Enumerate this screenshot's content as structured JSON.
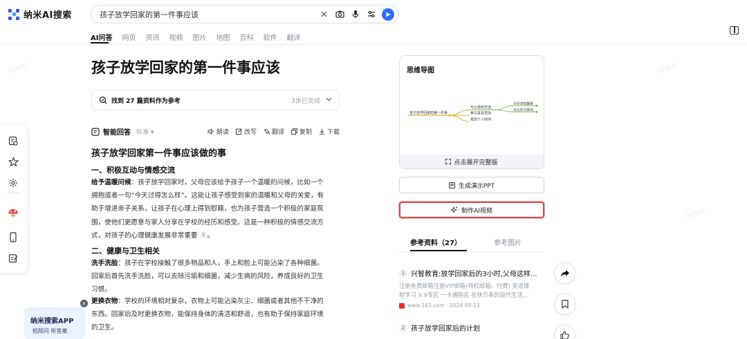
{
  "app": {
    "logo_text": "纳米AI搜索"
  },
  "search": {
    "value": "孩子放学回家的第一件事应该",
    "icons": [
      "clear-icon",
      "camera-icon",
      "microphone-icon",
      "settings-sliders-icon",
      "send-icon"
    ]
  },
  "tabs": [
    {
      "label": "AI问答",
      "active": true
    },
    {
      "label": "网页"
    },
    {
      "label": "资讯"
    },
    {
      "label": "视频"
    },
    {
      "label": "图片"
    },
    {
      "label": "地图"
    },
    {
      "label": "百科"
    },
    {
      "label": "软件"
    },
    {
      "label": "翻译"
    }
  ],
  "main": {
    "title": "孩子放学回家的第一件事应该",
    "ref_summary": {
      "label": "找到 27 篇资料作为参考",
      "steps": "3步已完成"
    },
    "answer": {
      "label": "智能回答",
      "mode": "标准",
      "tools": {
        "read": "朗读",
        "rewrite": "改写",
        "translate": "翻译",
        "copy": "复制",
        "download": "下载"
      }
    },
    "heading": "孩子放学回家第一件事应该做的事",
    "sections": [
      {
        "title": "一、积极互动与情感交流",
        "bold": "给予温暖问候",
        "lines": [
          "：孩子放学回家时，父母应该给予孩子一个温暖的问候，比如一个",
          "拥抱或者一句“今天过得怎么样”。这能让孩子感受到家的温暖和父母的关爱，有",
          "助于增进亲子关系，让孩子在心理上得到慰藉，也为孩子营造一个积极的家庭氛",
          "围，使他们更愿意与家人分享在学校的经历和感受。这是一种积极的情感交流方",
          "式，对孩子的心理健康发展非常重要"
        ],
        "cite": "1"
      },
      {
        "title": "二、健康与卫生相关",
        "bold": "洗手洗脸",
        "lines": [
          "：孩子在学校接触了很多物品和人，手上和脸上可能沾染了各种细菌。",
          "回家后首先洗手洗脸，可以去除污垢和细菌，减少生病的风险，养成良好的卫生",
          "习惯。"
        ]
      },
      {
        "bold": "更换衣物",
        "lines": [
          "：学校的环境相对复杂，衣物上可能沾染灰尘、细菌或者其他不干净的",
          "东西。回家后及时更换衣物，能保持身体的清洁和舒适，也有助于保持家庭环境",
          "的卫生。"
        ]
      }
    ]
  },
  "promo": {
    "title": "纳米搜索APP",
    "subtitle": "拍照问 听答案",
    "close": "×"
  },
  "mindmap": {
    "title": "思维导图",
    "root": "孩子放学回家的第一件事",
    "branches": [
      "与父母的交流",
      "参与家务劳动",
      "规划个人时间"
    ],
    "leaves": [
      "分享学校趣事",
      "讨论学习情况"
    ],
    "expand_label": "点击展开完整版"
  },
  "actions": {
    "ppt": "生成演示PPT",
    "video": "制作AI视频"
  },
  "references": {
    "tab_docs": "参考资料（27）",
    "tab_images": "参考图片",
    "items": [
      {
        "num": "1",
        "title": "兴智教育:放学回家后的3小时,父母这样...",
        "snippet": [
          "注册免费邮箱注册VIP邮箱(特权邮箱，付费) 英语课",
          "程学习 9.9专区 一卡通购买 在快节奏的现代生活..."
        ],
        "source": "www.163.com · 2024-09-13"
      },
      {
        "num": "2",
        "title": "孩子放学回家后的计划"
      }
    ]
  },
  "float_buttons": [
    "share-icon",
    "bookmark-icon",
    "like-icon"
  ],
  "colors": {
    "accent": "#2e6ef5",
    "highlight": "#e04646",
    "text": "#111111"
  }
}
